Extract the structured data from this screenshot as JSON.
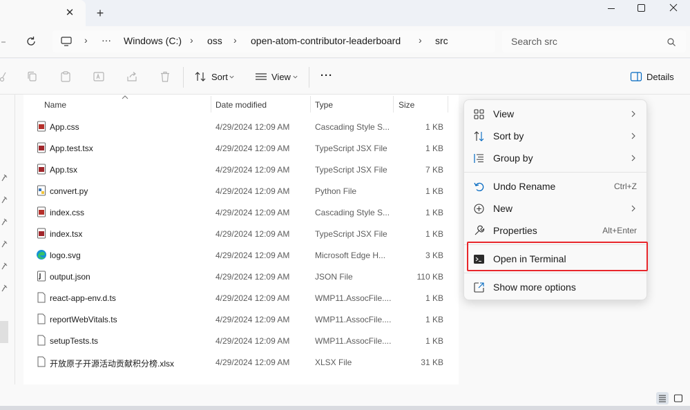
{
  "titlebar": {
    "close_tab_glyph": "✕",
    "new_tab_glyph": "+"
  },
  "address": {
    "more_glyph": "···",
    "crumbs": [
      "Windows (C:)",
      "oss",
      "open-atom-contributor-leaderboard",
      "src"
    ],
    "separator": "›"
  },
  "search": {
    "placeholder": "Search src"
  },
  "toolbar": {
    "sort_label": "Sort",
    "view_label": "View",
    "more_glyph": "···",
    "details_label": "Details"
  },
  "columns": {
    "name": "Name",
    "date": "Date modified",
    "type": "Type",
    "size": "Size"
  },
  "files": [
    {
      "name": "App.css",
      "date": "4/29/2024 12:09 AM",
      "type": "Cascading Style S...",
      "size": "1 KB",
      "icon": "css-file-icon"
    },
    {
      "name": "App.test.tsx",
      "date": "4/29/2024 12:09 AM",
      "type": "TypeScript JSX File",
      "size": "1 KB",
      "icon": "tsx-file-icon"
    },
    {
      "name": "App.tsx",
      "date": "4/29/2024 12:09 AM",
      "type": "TypeScript JSX File",
      "size": "7 KB",
      "icon": "tsx-file-icon"
    },
    {
      "name": "convert.py",
      "date": "4/29/2024 12:09 AM",
      "type": "Python File",
      "size": "1 KB",
      "icon": "python-file-icon"
    },
    {
      "name": "index.css",
      "date": "4/29/2024 12:09 AM",
      "type": "Cascading Style S...",
      "size": "1 KB",
      "icon": "css-file-icon"
    },
    {
      "name": "index.tsx",
      "date": "4/29/2024 12:09 AM",
      "type": "TypeScript JSX File",
      "size": "1 KB",
      "icon": "tsx-file-icon"
    },
    {
      "name": "logo.svg",
      "date": "4/29/2024 12:09 AM",
      "type": "Microsoft Edge H...",
      "size": "3 KB",
      "icon": "edge-icon"
    },
    {
      "name": "output.json",
      "date": "4/29/2024 12:09 AM",
      "type": "JSON File",
      "size": "110 KB",
      "icon": "json-file-icon"
    },
    {
      "name": "react-app-env.d.ts",
      "date": "4/29/2024 12:09 AM",
      "type": "WMP11.AssocFile....",
      "size": "1 KB",
      "icon": "blank-file-icon"
    },
    {
      "name": "reportWebVitals.ts",
      "date": "4/29/2024 12:09 AM",
      "type": "WMP11.AssocFile....",
      "size": "1 KB",
      "icon": "blank-file-icon"
    },
    {
      "name": "setupTests.ts",
      "date": "4/29/2024 12:09 AM",
      "type": "WMP11.AssocFile....",
      "size": "1 KB",
      "icon": "blank-file-icon"
    },
    {
      "name": "开放原子开源活动贡献积分榜.xlsx",
      "date": "4/29/2024 12:09 AM",
      "type": "XLSX File",
      "size": "31 KB",
      "icon": "blank-file-icon"
    }
  ],
  "context_menu": {
    "view": "View",
    "sort_by": "Sort by",
    "group_by": "Group by",
    "undo_rename": "Undo Rename",
    "undo_shortcut": "Ctrl+Z",
    "new": "New",
    "properties": "Properties",
    "properties_shortcut": "Alt+Enter",
    "open_terminal": "Open in Terminal",
    "show_more": "Show more options"
  },
  "colors": {
    "highlight": "#e8262b",
    "accent": "#0067c0"
  }
}
